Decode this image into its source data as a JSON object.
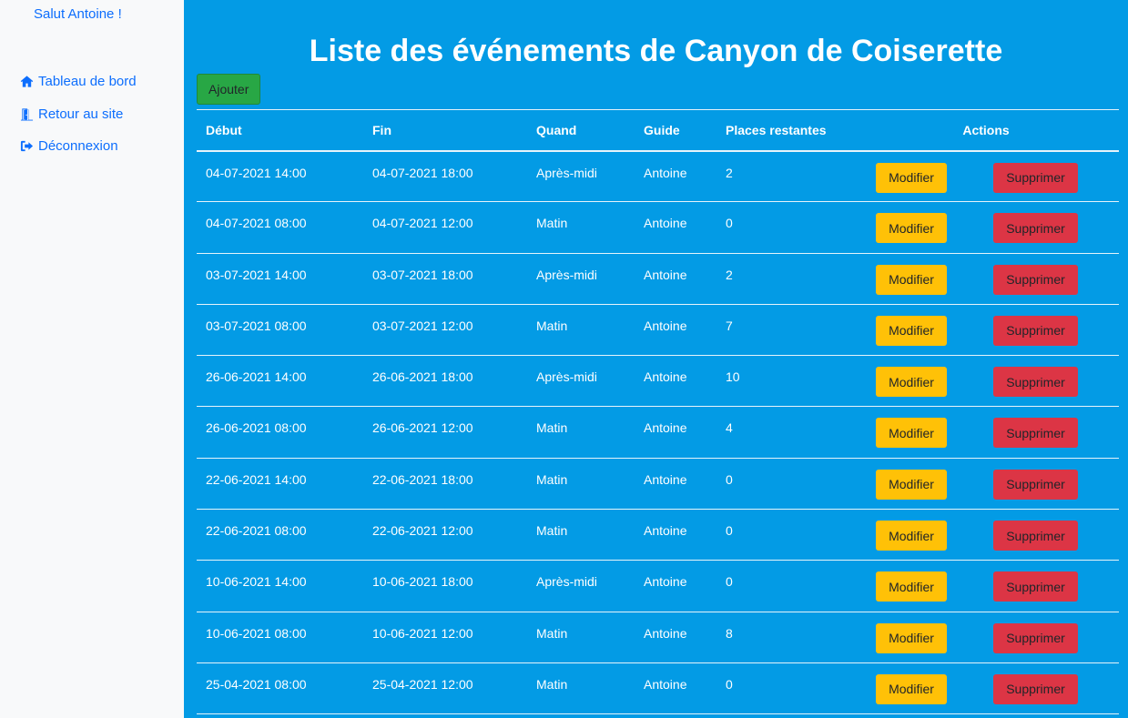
{
  "sidebar": {
    "greeting": "Salut Antoine !",
    "items": [
      {
        "label": "Tableau de bord",
        "icon": "home-icon"
      },
      {
        "label": "Retour au site",
        "icon": "door-open-icon"
      },
      {
        "label": "Déconnexion",
        "icon": "sign-out-icon"
      }
    ]
  },
  "main": {
    "title": "Liste des événements de Canyon de Coiserette",
    "add_label": "Ajouter",
    "columns": [
      "Début",
      "Fin",
      "Quand",
      "Guide",
      "Places restantes",
      "Actions"
    ],
    "edit_label": "Modifier",
    "delete_label": "Supprimer",
    "rows": [
      {
        "debut": "04-07-2021 14:00",
        "fin": "04-07-2021 18:00",
        "quand": "Après-midi",
        "guide": "Antoine",
        "places": "2"
      },
      {
        "debut": "04-07-2021 08:00",
        "fin": "04-07-2021 12:00",
        "quand": "Matin",
        "guide": "Antoine",
        "places": "0"
      },
      {
        "debut": "03-07-2021 14:00",
        "fin": "03-07-2021 18:00",
        "quand": "Après-midi",
        "guide": "Antoine",
        "places": "2"
      },
      {
        "debut": "03-07-2021 08:00",
        "fin": "03-07-2021 12:00",
        "quand": "Matin",
        "guide": "Antoine",
        "places": "7"
      },
      {
        "debut": "26-06-2021 14:00",
        "fin": "26-06-2021 18:00",
        "quand": "Après-midi",
        "guide": "Antoine",
        "places": "10"
      },
      {
        "debut": "26-06-2021 08:00",
        "fin": "26-06-2021 12:00",
        "quand": "Matin",
        "guide": "Antoine",
        "places": "4"
      },
      {
        "debut": "22-06-2021 14:00",
        "fin": "22-06-2021 18:00",
        "quand": "Matin",
        "guide": "Antoine",
        "places": "0"
      },
      {
        "debut": "22-06-2021 08:00",
        "fin": "22-06-2021 12:00",
        "quand": "Matin",
        "guide": "Antoine",
        "places": "0"
      },
      {
        "debut": "10-06-2021 14:00",
        "fin": "10-06-2021 18:00",
        "quand": "Après-midi",
        "guide": "Antoine",
        "places": "0"
      },
      {
        "debut": "10-06-2021 08:00",
        "fin": "10-06-2021 12:00",
        "quand": "Matin",
        "guide": "Antoine",
        "places": "8"
      },
      {
        "debut": "25-04-2021 08:00",
        "fin": "25-04-2021 12:00",
        "quand": "Matin",
        "guide": "Antoine",
        "places": "0"
      }
    ]
  },
  "colors": {
    "sidebar_bg": "#f8f9fa",
    "main_bg": "#039be5",
    "link": "#0d6efd",
    "add": "#28a745",
    "edit": "#ffc107",
    "delete": "#dc3545"
  }
}
